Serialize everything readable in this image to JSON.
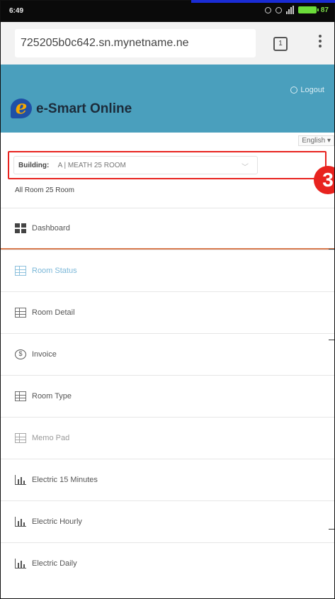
{
  "status_bar": {
    "time": "6:49",
    "battery": "87"
  },
  "address_bar": {
    "url": "725205b0c642.sn.mynetname.ne",
    "tab_count": "1"
  },
  "app": {
    "name": "e-Smart Online",
    "login_label": "Logout",
    "language": "English"
  },
  "building": {
    "label": "Building:",
    "value": "A | MEATH 25 ROOM",
    "subtitle": "All Room 25 Room"
  },
  "annotation": {
    "step_number": "3"
  },
  "nav": {
    "items": [
      {
        "label": "Dashboard",
        "icon": "dashboard-icon"
      },
      {
        "label": "Room Status",
        "icon": "room-status-icon"
      },
      {
        "label": "Room Detail",
        "icon": "room-detail-icon"
      },
      {
        "label": "Invoice",
        "icon": "invoice-icon"
      },
      {
        "label": "Room Type",
        "icon": "room-type-icon"
      },
      {
        "label": "Memo Pad",
        "icon": "memo-pad-icon"
      },
      {
        "label": "Electric 15 Minutes",
        "icon": "electric-chart-icon"
      },
      {
        "label": "Electric Hourly",
        "icon": "electric-chart-icon"
      },
      {
        "label": "Electric Daily",
        "icon": "electric-chart-icon"
      }
    ]
  },
  "colors": {
    "header": "#4a9fbd",
    "highlight": "#e8231f",
    "active_item": "#7ab7d8",
    "selected_underline": "#d97b4f"
  }
}
